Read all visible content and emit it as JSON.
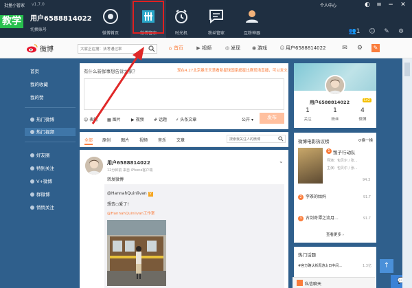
{
  "app": {
    "title": "批量小管家",
    "version": "v1.7.0",
    "user_center": "个人中心",
    "teach_badge": "教学",
    "account_name": "用户6588814022",
    "switch_account": "切换账号"
  },
  "topnav": [
    {
      "label": "微博首页",
      "icon": "weibo-home-icon"
    },
    {
      "label": "微博管家",
      "icon": "weibo-manager-icon"
    },
    {
      "label": "时光机",
      "icon": "time-machine-icon"
    },
    {
      "label": "粉丝管家",
      "icon": "fans-manager-icon"
    },
    {
      "label": "互粉神器",
      "icon": "mutual-follow-icon"
    }
  ],
  "top_tools": {
    "badge_count": "1"
  },
  "weibo_header": {
    "logo_text": "微博",
    "search_placeholder": "大家正在搜：法考通过率",
    "nav": [
      "首页",
      "视频",
      "发现",
      "游戏",
      "用户6588814022"
    ]
  },
  "sidebar": {
    "items": [
      "首页",
      "我的收藏",
      "我的赞",
      "热门微博",
      "热门视频",
      "好友圈",
      "特别关注",
      "V+微博",
      "群微博",
      "悄悄关注"
    ]
  },
  "composer": {
    "prompt": "有什么新鲜事想告诉大家？",
    "promo": "现在4.27北京暴乐天慧看新星球国家超星比赛现场直播，可以发文",
    "tools": [
      "表情",
      "图片",
      "视频",
      "话题",
      "头条文章"
    ],
    "visibility": "公开",
    "publish": "发布"
  },
  "feed_tabs": {
    "tabs": [
      "全部",
      "原创",
      "图片",
      "视频",
      "音乐",
      "文章"
    ],
    "search_placeholder": "搜索我关注人的微博"
  },
  "post": {
    "author": "用户6588814022",
    "meta": "12分钟前 来自 iPhone客户端",
    "text": "转发微博",
    "repost_author": "@HannahQuinlivan",
    "repost_text": "想去○爱了!",
    "repost_link": "@HannahQuinlivan工作室"
  },
  "profile": {
    "name": "用户6588814022",
    "level": "Lv2",
    "stats": [
      {
        "num": "1",
        "label": "关注"
      },
      {
        "num": "1",
        "label": "粉丝"
      },
      {
        "num": "4",
        "label": "微博"
      }
    ]
  },
  "movies": {
    "title": "微博电影热议榜",
    "refresh": "换一换",
    "top": {
      "rank": "1",
      "name": "叛子行动队",
      "info1": "导演：包贝尔 / 张...",
      "info2": "主演：包贝尔 / 张...",
      "info3": "",
      "score": "94.3"
    },
    "rows": [
      {
        "rank": "2",
        "name": "李茶的姑妈",
        "score": "91.7"
      },
      {
        "rank": "3",
        "name": "古剑奇谭之流月...",
        "score": "91.7"
      }
    ],
    "more": "查看更多"
  },
  "hot_topics": {
    "title": "热门话题",
    "item1": "#官方确认新周游太日中间...",
    "count1": "1.3亿"
  },
  "chat": {
    "label": "私信聊天"
  }
}
